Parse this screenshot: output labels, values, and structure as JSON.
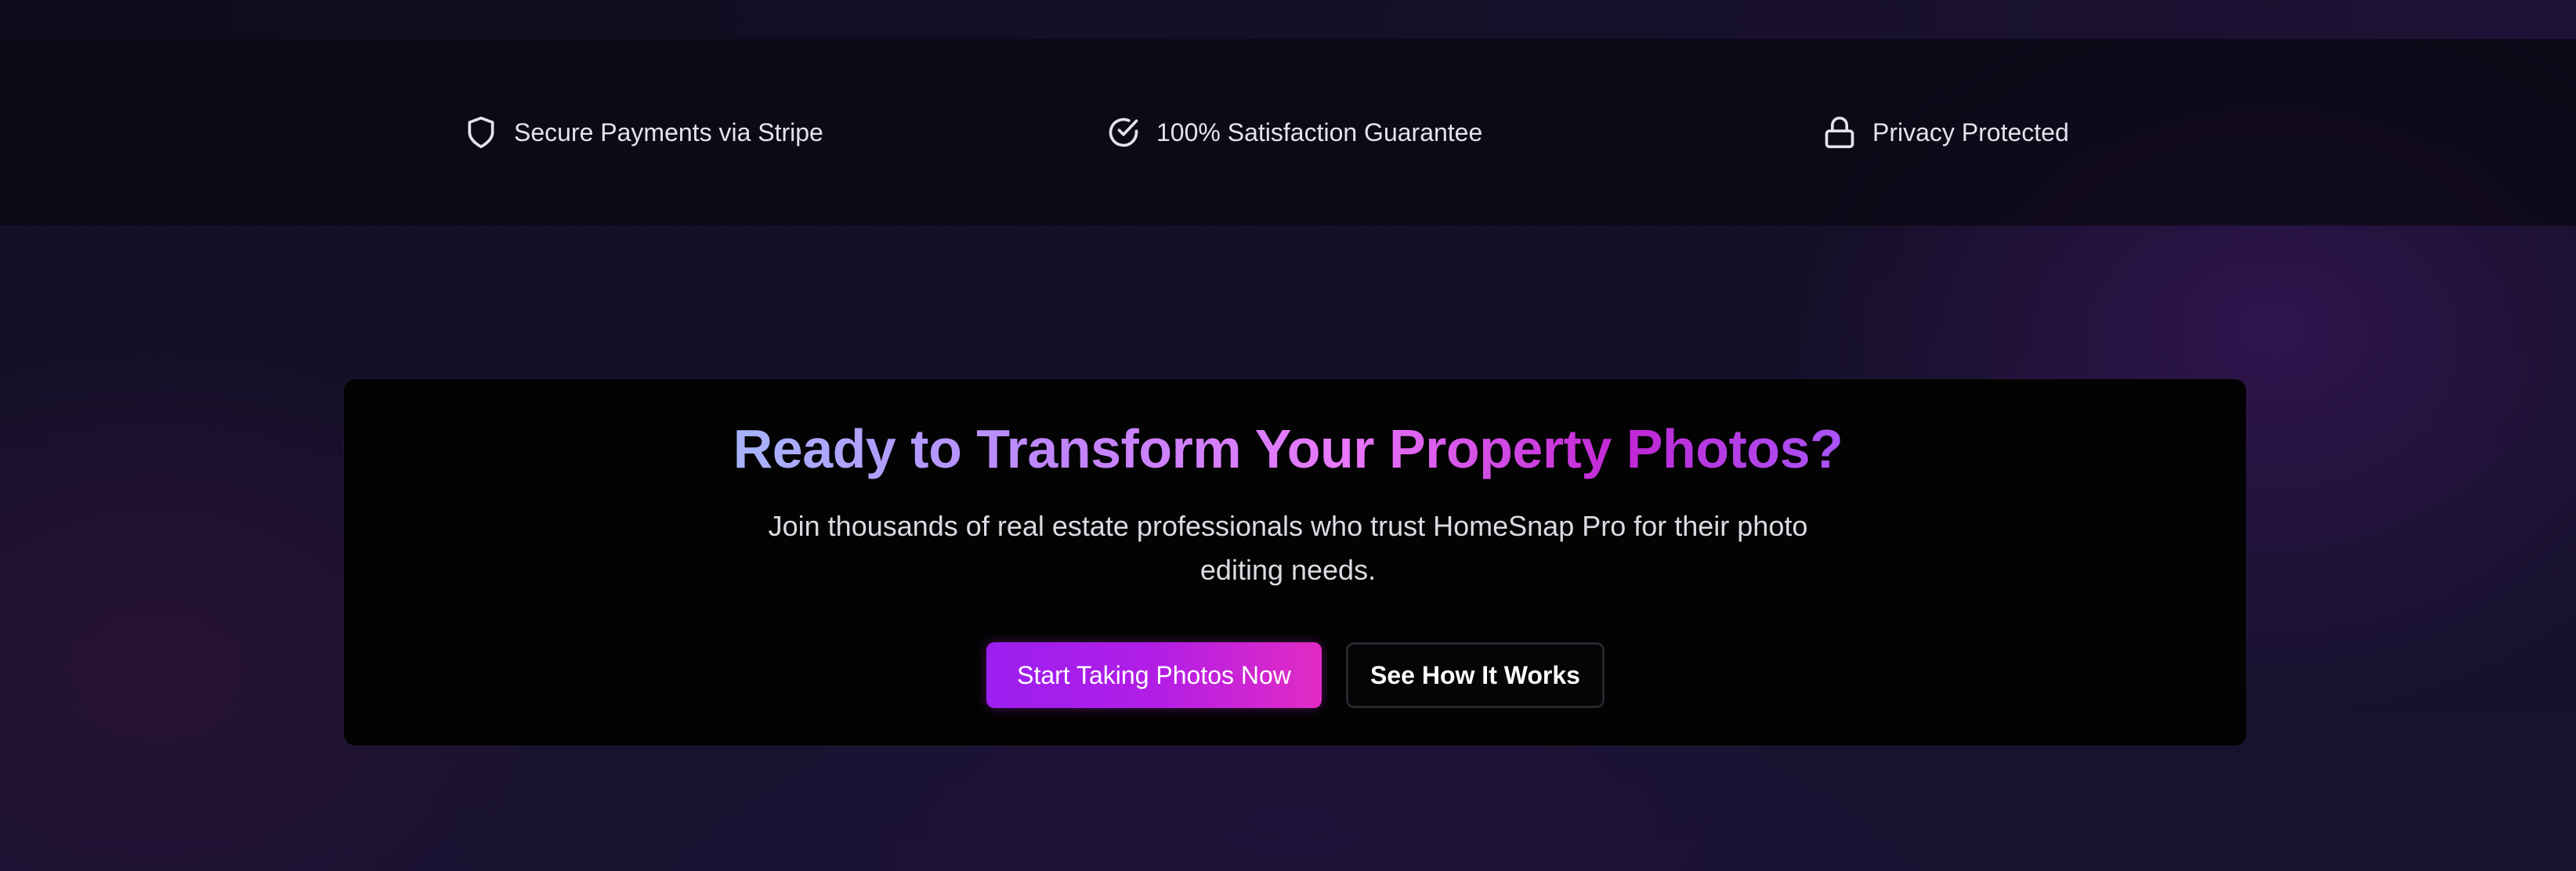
{
  "trust_bar": {
    "items": [
      {
        "icon": "shield-icon",
        "label": "Secure Payments via Stripe"
      },
      {
        "icon": "check-circle-icon",
        "label": "100% Satisfaction Guarantee"
      },
      {
        "icon": "lock-icon",
        "label": "Privacy Protected"
      }
    ]
  },
  "cta": {
    "title": "Ready to Transform Your Property Photos?",
    "subtitle": "Join thousands of real estate professionals who trust HomeSnap Pro for their photo editing needs.",
    "primary_button": "Start Taking Photos Now",
    "secondary_button": "See How It Works"
  },
  "colors": {
    "accent_gradient_start": "#9b1ff0",
    "accent_gradient_end": "#e22bc4",
    "title_gradient_start": "#a5b4fc",
    "title_gradient_end": "#a855f7",
    "card_background": "#030303"
  }
}
